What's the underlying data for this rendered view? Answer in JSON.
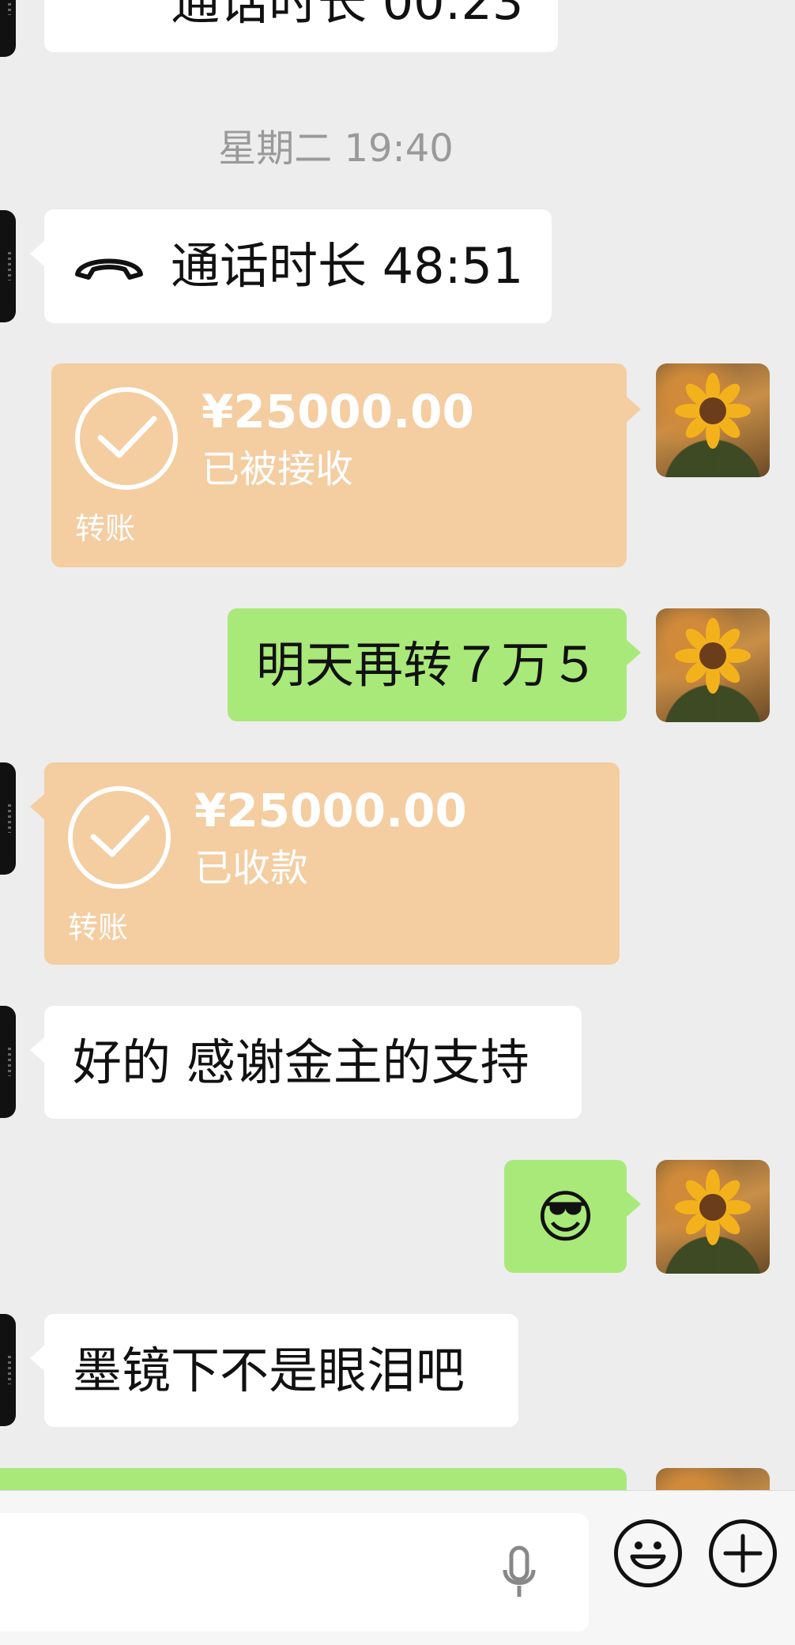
{
  "chat": {
    "top_partial_text": "通话时长 00:23",
    "timestamp": "星期二 19:40",
    "call": {
      "icon": "phone-hangup-icon",
      "text": "通话时长 48:51"
    },
    "transfer_1": {
      "amount": "¥25000.00",
      "status": "已被接收",
      "label": "转账"
    },
    "msg_green_1": "明天再转７万５",
    "transfer_2": {
      "amount": "¥25000.00",
      "status": "已收款",
      "label": "转账"
    },
    "msg_white_1": "好的 感谢金主的支持",
    "msg_emoji": "😎",
    "msg_white_2": "墨镜下不是眼泪吧"
  },
  "input_bar": {
    "input_value": "",
    "mic_icon": "microphone-icon",
    "emoji_icon": "smiley-icon",
    "plus_icon": "plus-icon"
  },
  "colors": {
    "background": "#ededed",
    "sent_bubble": "#a9e97a",
    "received_bubble": "#ffffff",
    "transfer_card": "#f4cda1",
    "timestamp_text": "#9a9a9a"
  }
}
